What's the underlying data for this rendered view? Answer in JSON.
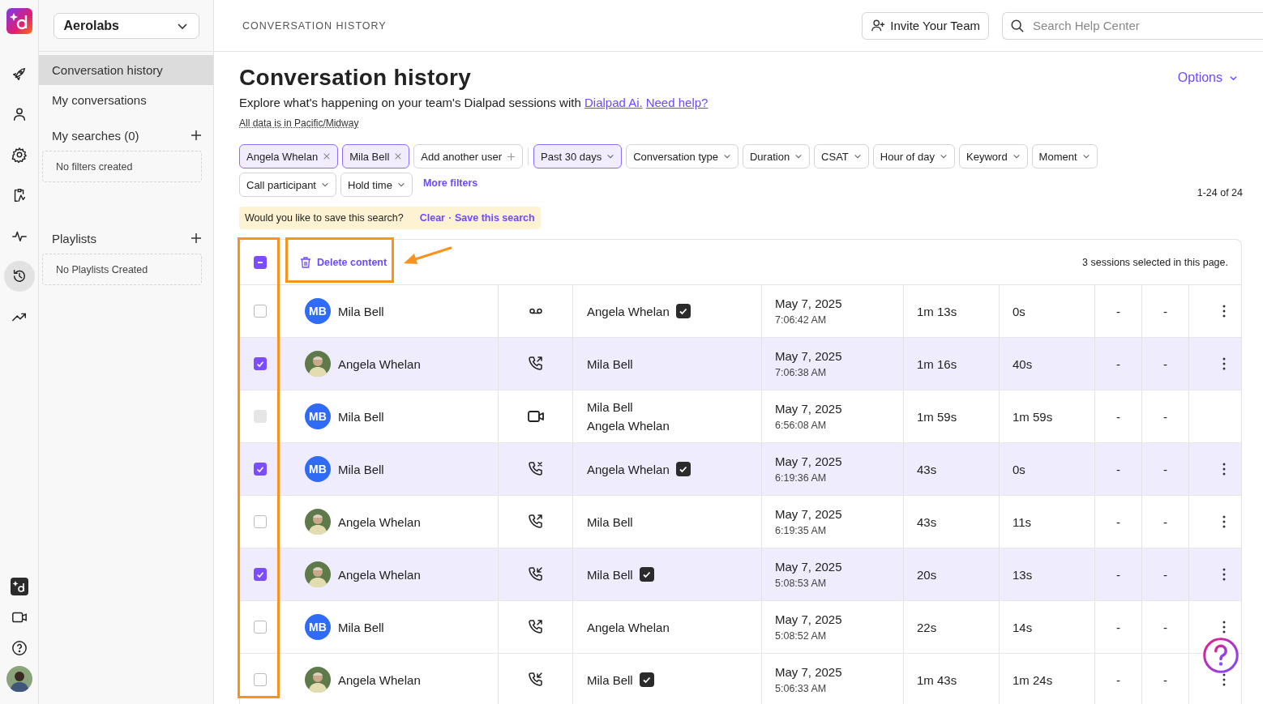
{
  "rail": {
    "top": [
      {
        "kind": "rocket",
        "selected": false
      },
      {
        "kind": "person",
        "selected": false
      },
      {
        "kind": "gear",
        "selected": false
      },
      {
        "kind": "clipboard",
        "selected": false
      },
      {
        "kind": "pulse",
        "selected": false
      },
      {
        "kind": "history",
        "selected": true
      },
      {
        "kind": "trend",
        "selected": false
      }
    ],
    "bottom": [
      {
        "kind": "ai"
      },
      {
        "kind": "video"
      },
      {
        "kind": "help"
      },
      {
        "kind": "avatar"
      }
    ]
  },
  "sidebar": {
    "org": "Aerolabs",
    "items": [
      {
        "label": "Conversation history",
        "selected": true
      },
      {
        "label": "My conversations",
        "selected": false
      }
    ],
    "sections": [
      {
        "title": "My searches (0)",
        "empty": "No filters created"
      },
      {
        "title": "Playlists",
        "empty": "No Playlists Created"
      }
    ]
  },
  "header": {
    "breadcrumb": "CONVERSATION HISTORY",
    "invite": "Invite Your Team",
    "search_placeholder": "Search Help Center"
  },
  "page": {
    "title": "Conversation history",
    "intro": "Explore what's happening on your team's Dialpad sessions with",
    "links": [
      "Dialpad Ai.",
      "Need help?"
    ],
    "timezone": "All data is in Pacific/Midway",
    "options": "Options"
  },
  "filters": [
    [
      {
        "kind": "user",
        "label": "Angela Whelan",
        "selected": true
      },
      {
        "kind": "user",
        "label": "Mila Bell",
        "selected": true
      },
      {
        "kind": "add",
        "label": "Add another user",
        "selected": false
      },
      {
        "kind": "divider"
      },
      {
        "kind": "dropdown",
        "label": "Past 30 days",
        "selected": true
      },
      {
        "kind": "dropdown",
        "label": "Conversation type",
        "selected": false
      },
      {
        "kind": "dropdown",
        "label": "Duration",
        "selected": false
      },
      {
        "kind": "dropdown",
        "label": "CSAT",
        "selected": false
      },
      {
        "kind": "dropdown",
        "label": "Hour of day",
        "selected": false
      },
      {
        "kind": "dropdown",
        "label": "Keyword",
        "selected": false
      },
      {
        "kind": "dropdown",
        "label": "Moment",
        "selected": false
      }
    ],
    [
      {
        "kind": "dropdown",
        "label": "Call participant",
        "selected": false
      },
      {
        "kind": "dropdown",
        "label": "Hold time",
        "selected": false
      },
      {
        "kind": "link",
        "label": "More filters"
      }
    ]
  ],
  "range": "1-24 of 24",
  "save_banner": {
    "question": "Would you like to save this search?",
    "actions": [
      "Clear",
      "Save this search"
    ]
  },
  "table": {
    "select_all": {
      "indeterminate": true
    },
    "delete": "Delete content",
    "selected_note": "3 sessions selected in this page.",
    "rows": [
      {
        "checked": false,
        "disabled": false,
        "avatar": {
          "kind": "initials",
          "text": "MB"
        },
        "user": "Mila Bell",
        "kind": "voicemail",
        "contacts": [
          {
            "name": "Angela Whelan",
            "verified": true
          }
        ],
        "date": "May 7, 2025",
        "time": "7:06:42 AM",
        "duration": "1m 13s",
        "talk": "0s",
        "column_7": "-",
        "column_8": "-"
      },
      {
        "checked": true,
        "disabled": false,
        "avatar": {
          "kind": "photo"
        },
        "user": "Angela Whelan",
        "kind": "outgoing",
        "contacts": [
          {
            "name": "Mila Bell",
            "verified": false
          }
        ],
        "date": "May 7, 2025",
        "time": "7:06:38 AM",
        "duration": "1m 16s",
        "talk": "40s",
        "column_7": "-",
        "column_8": "-"
      },
      {
        "checked": false,
        "disabled": true,
        "avatar": {
          "kind": "initials",
          "text": "MB"
        },
        "user": "Mila Bell",
        "kind": "video",
        "contacts": [
          {
            "name": "Mila Bell",
            "verified": false
          },
          {
            "name": "Angela Whelan",
            "verified": false
          }
        ],
        "date": "May 7, 2025",
        "time": "6:56:08 AM",
        "duration": "1m 59s",
        "talk": "1m 59s",
        "column_7": "-",
        "column_8": "-"
      },
      {
        "checked": true,
        "disabled": false,
        "avatar": {
          "kind": "initials",
          "text": "MB"
        },
        "user": "Mila Bell",
        "kind": "missed",
        "contacts": [
          {
            "name": "Angela Whelan",
            "verified": true
          }
        ],
        "date": "May 7, 2025",
        "time": "6:19:36 AM",
        "duration": "43s",
        "talk": "0s",
        "column_7": "-",
        "column_8": "-"
      },
      {
        "checked": false,
        "disabled": false,
        "avatar": {
          "kind": "photo"
        },
        "user": "Angela Whelan",
        "kind": "outgoing",
        "contacts": [
          {
            "name": "Mila Bell",
            "verified": false
          }
        ],
        "date": "May 7, 2025",
        "time": "6:19:35 AM",
        "duration": "43s",
        "talk": "11s",
        "column_7": "-",
        "column_8": "-"
      },
      {
        "checked": true,
        "disabled": false,
        "avatar": {
          "kind": "photo"
        },
        "user": "Angela Whelan",
        "kind": "incoming",
        "contacts": [
          {
            "name": "Mila Bell",
            "verified": true
          }
        ],
        "date": "May 7, 2025",
        "time": "5:08:53 AM",
        "duration": "20s",
        "talk": "13s",
        "column_7": "-",
        "column_8": "-"
      },
      {
        "checked": false,
        "disabled": false,
        "avatar": {
          "kind": "initials",
          "text": "MB"
        },
        "user": "Mila Bell",
        "kind": "outgoing",
        "contacts": [
          {
            "name": "Angela Whelan",
            "verified": false
          }
        ],
        "date": "May 7, 2025",
        "time": "5:08:52 AM",
        "duration": "22s",
        "talk": "14s",
        "column_7": "-",
        "column_8": "-"
      },
      {
        "checked": false,
        "disabled": false,
        "avatar": {
          "kind": "photo"
        },
        "user": "Angela Whelan",
        "kind": "incoming",
        "contacts": [
          {
            "name": "Mila Bell",
            "verified": true
          }
        ],
        "date": "May 7, 2025",
        "time": "5:06:33 AM",
        "duration": "1m 43s",
        "talk": "1m 24s",
        "column_7": "-",
        "column_8": "-"
      }
    ]
  }
}
